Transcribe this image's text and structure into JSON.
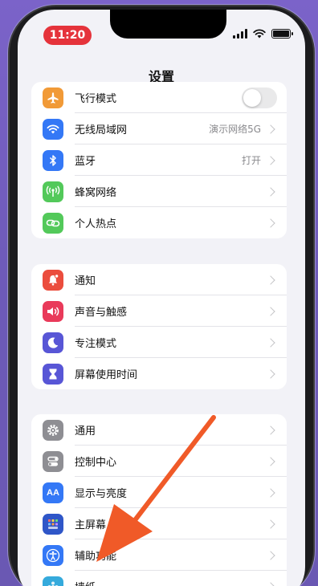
{
  "status_bar": {
    "time": "11:20"
  },
  "nav": {
    "title": "设置"
  },
  "groups": [
    {
      "rows": [
        {
          "label": "飞行模式",
          "color": "#f19a37",
          "icon": "airplane-icon",
          "control": "toggle",
          "toggle_on": false
        },
        {
          "label": "无线局域网",
          "color": "#3478f6",
          "icon": "wifi-icon",
          "value": "演示网络5G"
        },
        {
          "label": "蓝牙",
          "color": "#3478f6",
          "icon": "bluetooth-icon",
          "value": "打开"
        },
        {
          "label": "蜂窝网络",
          "color": "#53c95a",
          "icon": "cellular-icon"
        },
        {
          "label": "个人热点",
          "color": "#53c95a",
          "icon": "hotspot-icon"
        }
      ]
    },
    {
      "rows": [
        {
          "label": "通知",
          "color": "#eb4d3d",
          "icon": "notification-icon"
        },
        {
          "label": "声音与触感",
          "color": "#e93a5a",
          "icon": "speaker-icon"
        },
        {
          "label": "专注模式",
          "color": "#5856d6",
          "icon": "moon-icon"
        },
        {
          "label": "屏幕使用时间",
          "color": "#5856d6",
          "icon": "hourglass-icon"
        }
      ]
    },
    {
      "rows": [
        {
          "label": "通用",
          "color": "#8e8e93",
          "icon": "gear-icon"
        },
        {
          "label": "控制中心",
          "color": "#8e8e93",
          "icon": "control-center-icon"
        },
        {
          "label": "显示与亮度",
          "color": "#3478f6",
          "icon": "display-icon"
        },
        {
          "label": "主屏幕",
          "color": "#3478f6",
          "icon": "home-screen-icon"
        },
        {
          "label": "辅助功能",
          "color": "#3478f6",
          "icon": "accessibility-icon"
        },
        {
          "label": "墙纸",
          "color": "#35aadc",
          "icon": "wallpaper-icon"
        }
      ]
    }
  ],
  "annotation": {
    "arrow_color": "#f05a28",
    "target": "辅助功能"
  }
}
